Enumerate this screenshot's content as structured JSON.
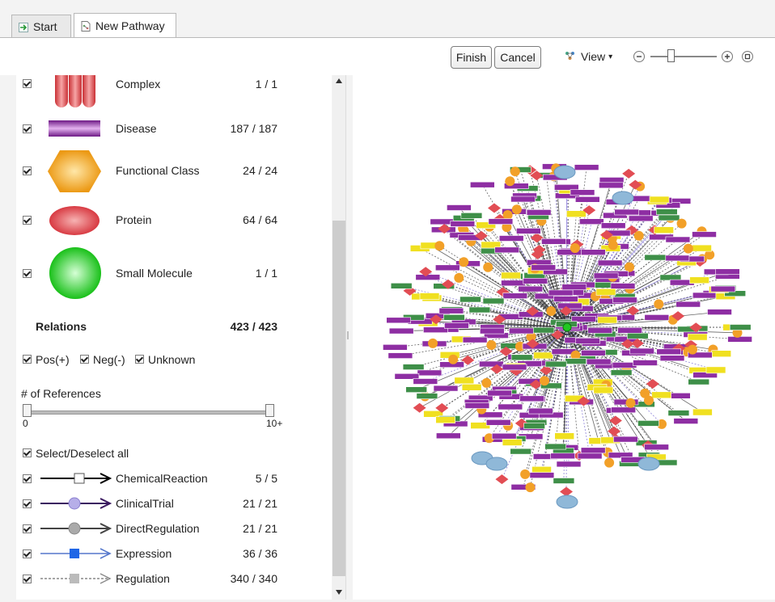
{
  "tabs": [
    {
      "label": "Start"
    },
    {
      "label": "New Pathway"
    }
  ],
  "toolbar": {
    "finish_label": "Finish",
    "cancel_label": "Cancel",
    "view_label": "View",
    "view_caret": "▾"
  },
  "legend": {
    "entities": [
      {
        "label": "Complex",
        "count": "1 /   1",
        "shape": "complex",
        "color": "#e2595c",
        "checked": true
      },
      {
        "label": "Disease",
        "count": "187 / 187",
        "shape": "disease",
        "color": "#8e2ea3",
        "checked": true
      },
      {
        "label": "Functional Class",
        "count": "24 /  24",
        "shape": "hexagon",
        "color": "#f2a028",
        "checked": true
      },
      {
        "label": "Protein",
        "count": "64 /  64",
        "shape": "ellipse",
        "color": "#e24d54",
        "checked": true
      },
      {
        "label": "Small Molecule",
        "count": "1 /   1",
        "shape": "circle",
        "color": "#22c822",
        "checked": true
      }
    ],
    "relations_heading": "Relations",
    "relations_count": "423 / 423",
    "filters": [
      {
        "label": "Pos(+)",
        "checked": true
      },
      {
        "label": "Neg(-)",
        "checked": true
      },
      {
        "label": "Unknown",
        "checked": true
      }
    ],
    "references": {
      "label": "# of References",
      "min_label": "0",
      "max_label": "10+"
    },
    "select_all_label": "Select/Deselect all",
    "relation_types": [
      {
        "label": "ChemicalReaction",
        "count": "5 /   5",
        "line_color": "#000000",
        "marker": "square-white",
        "checked": true
      },
      {
        "label": "ClinicalTrial",
        "count": "21 /  21",
        "line_color": "#3b1a60",
        "marker": "circle-lavender",
        "checked": true
      },
      {
        "label": "DirectRegulation",
        "count": "21 /  21",
        "line_color": "#444444",
        "marker": "circle-gray",
        "checked": true
      },
      {
        "label": "Expression",
        "count": "36 /  36",
        "line_color": "#5577cc",
        "marker": "square-blue",
        "checked": true
      },
      {
        "label": "Regulation",
        "count": "340 / 340",
        "line_color": "#888888",
        "marker": "square-gray",
        "checked": true
      }
    ]
  },
  "colors": {
    "disease": "#8e2ea3",
    "protein": "#e24d54",
    "functional_class": "#f2a028",
    "small_molecule": "#22c822",
    "green_node": "#3e8f48",
    "yellow_node": "#f0e020",
    "blue_node": "#8fb8d8"
  }
}
